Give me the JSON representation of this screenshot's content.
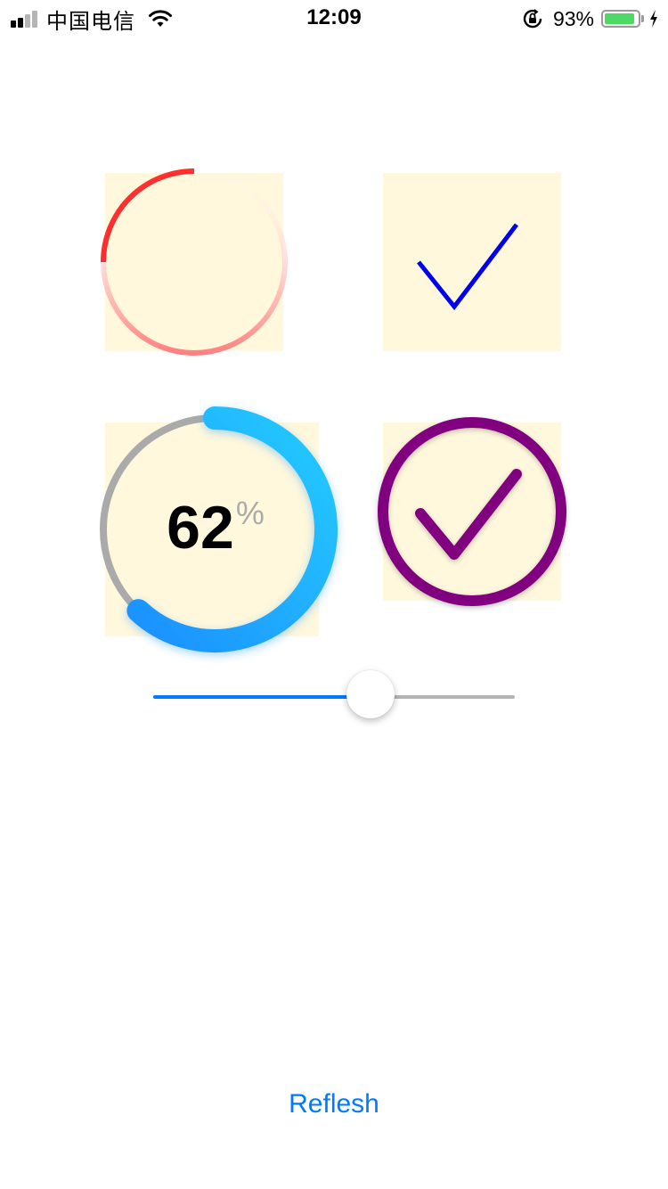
{
  "status_bar": {
    "carrier": "中国电信",
    "time": "12:09",
    "battery_percent_text": "93%",
    "battery_level": 0.93,
    "signal_bars_active": 2,
    "signal_bars_total": 4,
    "icons": [
      "signal-icon",
      "wifi-icon",
      "orientation-lock-icon",
      "battery-icon",
      "charging-bolt-icon"
    ]
  },
  "colors": {
    "box_background": "#fff8dc",
    "gradient_ring": "#ff1a1a",
    "checkmark_blue": "#0000ee",
    "progress_track": "#aaaaaa",
    "progress_start": "#1e90ff",
    "progress_end": "#22ccff",
    "checkmark_purple": "#800080",
    "slider_active": "#007aff",
    "slider_inactive": "#b5b5b5",
    "accent": "#007aff"
  },
  "progress": {
    "value": "62",
    "unit": "%",
    "fraction": 0.62
  },
  "slider": {
    "value": 0.6
  },
  "refresh_button": {
    "label": "Reflesh"
  }
}
